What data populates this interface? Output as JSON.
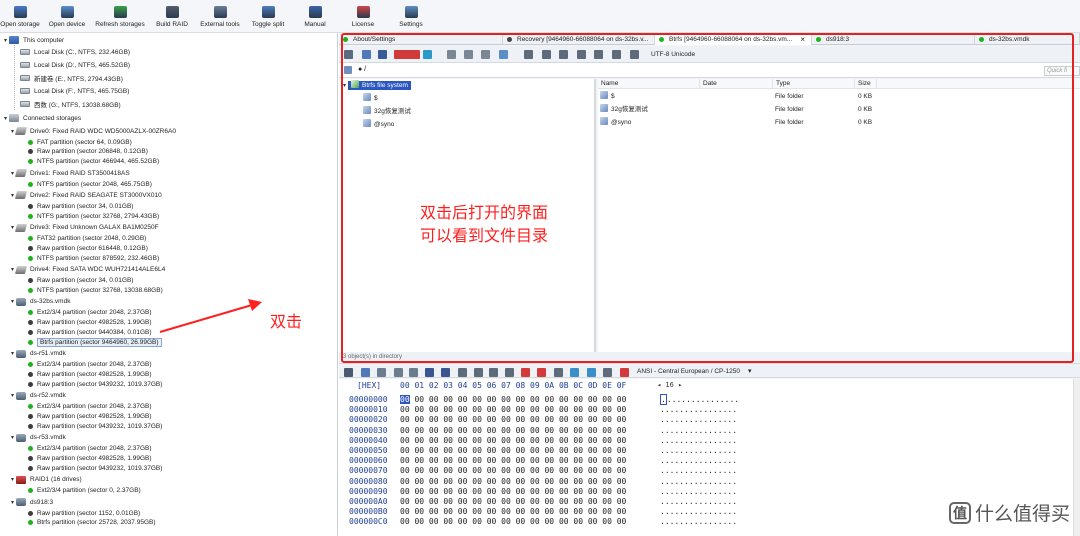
{
  "toolbar": {
    "items": [
      "Open storage",
      "Open device",
      "Refresh storages",
      "Build RAID",
      "External tools",
      "Toggle split",
      "Manual",
      "License",
      "Settings"
    ]
  },
  "tree": {
    "this_computer": "This computer",
    "local_disks": [
      "Local Disk (C:, NTFS, 232.46GB)",
      "Local Disk (D:, NTFS, 465.52GB)",
      "新建卷 (E:, NTFS, 2794.43GB)",
      "Local Disk (F:, NTFS, 465.75GB)",
      "西数 (G:, NTFS, 13038.68GB)"
    ],
    "connected_storages": "Connected storages",
    "nodes": [
      {
        "label": "Drive0: Fixed RAID WDC WD5000AZLX-00ZR6A0",
        "icon": "drive",
        "children": [
          {
            "label": "FAT partition (sector 64, 0.09GB)",
            "dot": "green"
          },
          {
            "label": "Raw partition (sector 206848, 0.12GB)",
            "dot": "dark"
          },
          {
            "label": "NTFS partition (sector 466944, 465.52GB)",
            "dot": "green"
          }
        ]
      },
      {
        "label": "Drive1: Fixed RAID ST3500418AS",
        "icon": "drive",
        "children": [
          {
            "label": "NTFS partition (sector 2048, 465.75GB)",
            "dot": "green"
          }
        ]
      },
      {
        "label": "Drive2: Fixed RAID SEAGATE  ST3000VX010",
        "icon": "drive",
        "children": [
          {
            "label": "Raw partition (sector 34, 0.01GB)",
            "dot": "dark"
          },
          {
            "label": "NTFS partition (sector 32768, 2794.43GB)",
            "dot": "green"
          }
        ]
      },
      {
        "label": "Drive3: Fixed Unknown GALAX BA1M0250F",
        "icon": "drive",
        "children": [
          {
            "label": "FAT32 partition (sector 2048, 0.29GB)",
            "dot": "green"
          },
          {
            "label": "Raw partition (sector 616448, 0.12GB)",
            "dot": "dark"
          },
          {
            "label": "NTFS partition (sector 878592, 232.46GB)",
            "dot": "green"
          }
        ]
      },
      {
        "label": "Drive4: Fixed SATA WDC  WUH721414ALE6L4",
        "icon": "drive",
        "children": [
          {
            "label": "Raw partition (sector 34, 0.01GB)",
            "dot": "dark"
          },
          {
            "label": "NTFS partition (sector 32768, 13038.68GB)",
            "dot": "green"
          }
        ]
      },
      {
        "label": "ds-32bs.vmdk",
        "icon": "vmdk",
        "children": [
          {
            "label": "Ext2/3/4 partition (sector 2048, 2.37GB)",
            "dot": "green"
          },
          {
            "label": "Raw partition (sector 4982528, 1.99GB)",
            "dot": "dark"
          },
          {
            "label": "Raw partition (sector 9440384, 0.01GB)",
            "dot": "dark"
          },
          {
            "label": "Btrfs partition (sector 9464960, 26.99GB)",
            "dot": "green",
            "selected": true
          }
        ]
      },
      {
        "label": "ds-r51.vmdk",
        "icon": "vmdk",
        "children": [
          {
            "label": "Ext2/3/4 partition (sector 2048, 2.37GB)",
            "dot": "green"
          },
          {
            "label": "Raw partition (sector 4982528, 1.99GB)",
            "dot": "dark"
          },
          {
            "label": "Raw partition (sector 9439232, 1019.37GB)",
            "dot": "dark"
          }
        ]
      },
      {
        "label": "ds-r52.vmdk",
        "icon": "vmdk",
        "children": [
          {
            "label": "Ext2/3/4 partition (sector 2048, 2.37GB)",
            "dot": "green"
          },
          {
            "label": "Raw partition (sector 4982528, 1.99GB)",
            "dot": "dark"
          },
          {
            "label": "Raw partition (sector 9439232, 1019.37GB)",
            "dot": "dark"
          }
        ]
      },
      {
        "label": "ds-r53.vmdk",
        "icon": "vmdk",
        "children": [
          {
            "label": "Ext2/3/4 partition (sector 2048, 2.37GB)",
            "dot": "green"
          },
          {
            "label": "Raw partition (sector 4982528, 1.99GB)",
            "dot": "dark"
          },
          {
            "label": "Raw partition (sector 9439232, 1019.37GB)",
            "dot": "dark"
          }
        ]
      },
      {
        "label": "RAID1 (16 drives)",
        "icon": "raid",
        "children": [
          {
            "label": "Ext2/3/4 partition (sector 0, 2.37GB)",
            "dot": "green"
          }
        ]
      },
      {
        "label": "ds918:3",
        "icon": "vmdk",
        "children": [
          {
            "label": "Raw partition (sector 1152, 0.01GB)",
            "dot": "dark"
          },
          {
            "label": "Btrfs partition (sector 25728, 2037.95GB)",
            "dot": "green"
          }
        ]
      }
    ]
  },
  "tabs": [
    {
      "label": "About/Settings",
      "dot": "#1db31d"
    },
    {
      "label": "Recovery [9464960-66088064 on ds-32bs.v...",
      "dot": "#444444"
    },
    {
      "label": "Btrfs [9464960-66088064 on ds-32bs.vm...",
      "dot": "#1db31d",
      "active": true,
      "close": "×"
    },
    {
      "label": "ds918:3",
      "dot": "#1db31d"
    },
    {
      "label": "ds-32bs.vmdk",
      "dot": "#1db31d"
    }
  ],
  "encoding": "UTF-8 Unicode",
  "address": "● /",
  "quick_filter": "Quick fi",
  "fs_tree": {
    "root": "Btrfs file system",
    "children": [
      "$",
      "32g恢复测试",
      "@syno"
    ]
  },
  "file_list": {
    "columns": [
      "Name",
      "Date",
      "Type",
      "Size"
    ],
    "rows": [
      {
        "name": "$",
        "date": "",
        "type": "File folder",
        "size": "0 KB"
      },
      {
        "name": "32g恢复测试",
        "date": "",
        "type": "File folder",
        "size": "0 KB"
      },
      {
        "name": "@syno",
        "date": "",
        "type": "File folder",
        "size": "0 KB"
      }
    ]
  },
  "status_text": "3 object(s) in directory",
  "hex": {
    "encoding": "ANSI - Central European / CP-1250",
    "label": "[HEX]",
    "columns": "00 01 02 03 04 05 06 07 08 09 0A 0B 0C 0D 0E 0F",
    "width": "◂ 16 ▸",
    "offsets": [
      "00000000",
      "00000010",
      "00000020",
      "00000030",
      "00000040",
      "00000050",
      "00000060",
      "00000070",
      "00000080",
      "00000090",
      "000000A0",
      "000000B0",
      "000000C0"
    ],
    "bytes": "00 00 00 00 00 00 00 00 00 00 00 00 00 00 00 00",
    "first_byte": "00",
    "rest_first": " 00 00 00 00 00 00 00 00 00 00 00 00 00 00 00",
    "ascii": "................",
    "ascii_rest": "..............."
  },
  "annotations": {
    "opened_line1": "双击后打开的界面",
    "opened_line2": "可以看到文件目录",
    "double_click": "双击"
  },
  "watermark": {
    "badge": "值",
    "text": "什么值得买"
  },
  "colors": {
    "accent_red": "#e42020",
    "ok_green": "#1db31d",
    "selection": "#2c56c0"
  }
}
